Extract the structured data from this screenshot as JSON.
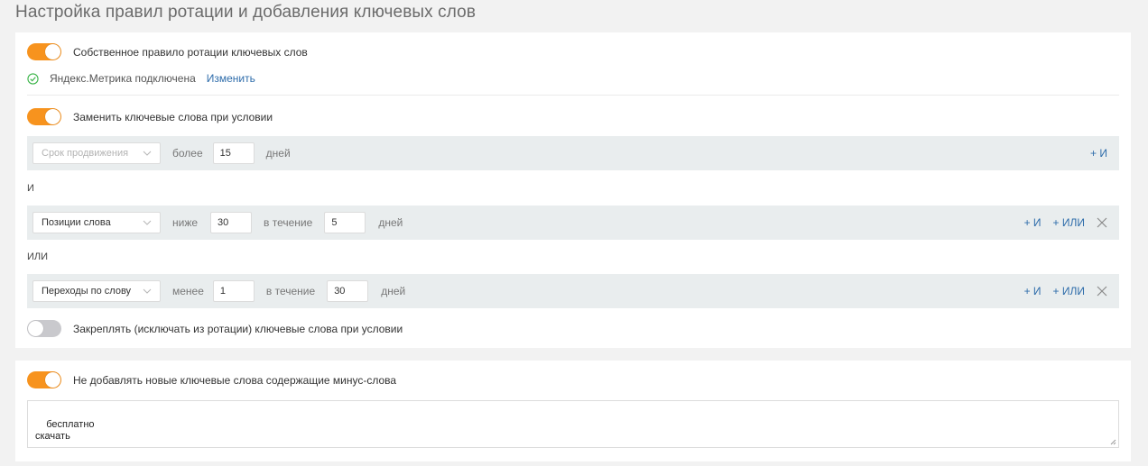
{
  "title": "Настройка правил ротации и добавления ключевых слов",
  "rotation": {
    "toggle_label": "Собственное правило ротации ключевых слов",
    "toggle_on": true,
    "metrika_status": "Яндекс.Метрика подключена",
    "metrika_change": "Изменить"
  },
  "replace": {
    "toggle_label": "Заменить ключевые слова при условии",
    "toggle_on": true,
    "conditions": [
      {
        "metric": "Срок продвижения",
        "metric_is_placeholder": true,
        "op": "более",
        "value": "15",
        "unit": "дней",
        "actions": [
          "+ И"
        ]
      },
      {
        "metric": "Позиции слова",
        "op": "ниже",
        "value": "30",
        "period_label": "в течение",
        "period": "5",
        "unit": "дней",
        "actions": [
          "+ И",
          "+ ИЛИ"
        ]
      },
      {
        "metric": "Переходы по слову",
        "op": "менее",
        "value": "1",
        "period_label": "в течение",
        "period": "30",
        "unit": "дней",
        "actions": [
          "+ И",
          "+ ИЛИ"
        ]
      }
    ],
    "logic": [
      "И",
      "ИЛИ"
    ]
  },
  "pin": {
    "toggle_label": "Закреплять (исключать из ротации) ключевые слова при условии",
    "toggle_on": false
  },
  "minus_words": {
    "toggle_label": "Не добавлять новые ключевые слова содержащие минус-слова",
    "toggle_on": true,
    "text": "бесплатно\nскачать"
  },
  "colors": {
    "accent": "#f7931e",
    "link": "#2f6dab",
    "row_bg": "#e9edee",
    "success": "#3cb54a"
  },
  "icons": {
    "status": "check-circle-icon",
    "select": "chevron-down-icon",
    "remove": "close-icon"
  }
}
